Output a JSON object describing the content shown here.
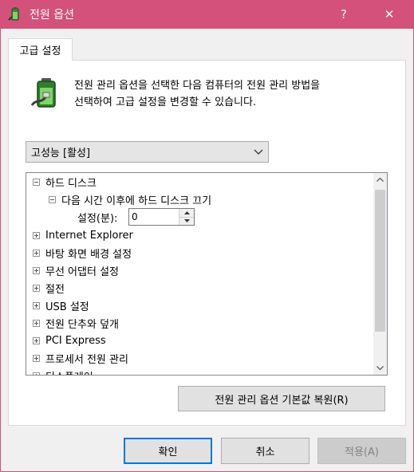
{
  "window": {
    "title": "전원 옵션",
    "help_label": "?",
    "close_label": "✕"
  },
  "tab": {
    "label": "고급 설정"
  },
  "description": {
    "line1": "전원 관리 옵션을 선택한 다음 컴퓨터의 전원 관리 방법을",
    "line2": "선택하여 고급 설정을 변경할 수 있습니다."
  },
  "plan_select": {
    "value": "고성능 [활성]"
  },
  "tree": {
    "items": [
      {
        "label": "하드 디스크",
        "expanded": true
      },
      {
        "label": "다음 시간 이후에 하드 디스크 끄기",
        "expanded": true
      },
      {
        "label": "설정(분):",
        "value": "0"
      },
      {
        "label": "Internet Explorer",
        "expanded": false
      },
      {
        "label": "바탕 화면 배경 설정",
        "expanded": false
      },
      {
        "label": "무선 어댑터 설정",
        "expanded": false
      },
      {
        "label": "절전",
        "expanded": false
      },
      {
        "label": "USB 설정",
        "expanded": false
      },
      {
        "label": "전원 단추와 덮개",
        "expanded": false
      },
      {
        "label": "PCI Express",
        "expanded": false
      },
      {
        "label": "프로세서 전원 관리",
        "expanded": false
      },
      {
        "label": "디스플레이",
        "expanded": false
      }
    ]
  },
  "buttons": {
    "restore": "전원 관리 옵션 기본값 복원(R)",
    "ok": "확인",
    "cancel": "취소",
    "apply": "적용(A)"
  },
  "icons": {
    "app": "power-options-icon",
    "battery": "battery-plug-icon",
    "dropdown": "chevron-down-icon",
    "spin_up": "spin-up-icon",
    "spin_down": "spin-down-icon",
    "scroll_up": "scroll-up-icon",
    "scroll_down": "scroll-down-icon"
  },
  "colors": {
    "titlebar": "#d3517a",
    "focus": "#0078d7"
  }
}
